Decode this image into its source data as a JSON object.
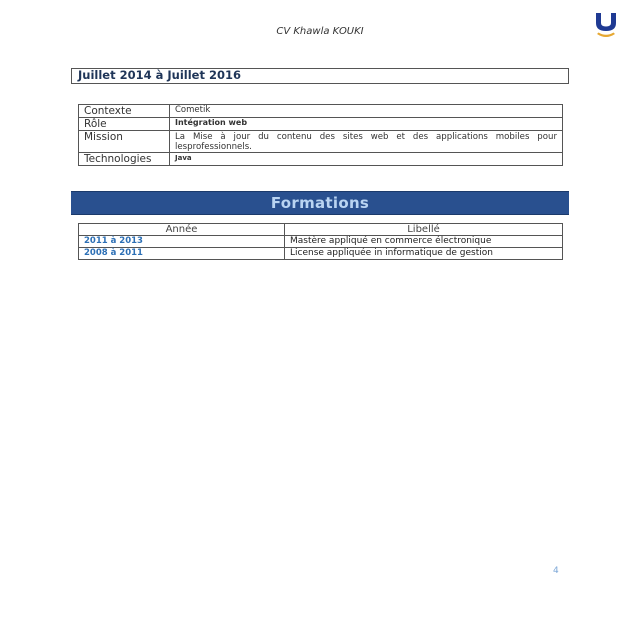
{
  "header": {
    "title": "CV Khawla KOUKI",
    "logo_color_primary": "#1f3a93",
    "logo_color_accent": "#e6a832"
  },
  "experience": {
    "period": "Juillet 2014 à Juillet 2016",
    "rows": [
      {
        "label": "Contexte",
        "value": "Cometik"
      },
      {
        "label": "Rôle",
        "value": "Intégration web"
      },
      {
        "label": "Mission",
        "value": "La Mise à jour du contenu des sites web et des applications mobiles pour lesprofessionnels."
      },
      {
        "label": "Technologies",
        "value": "Java"
      }
    ]
  },
  "formations": {
    "title": "Formations",
    "headers": {
      "year": "Année",
      "label": "Libellé"
    },
    "rows": [
      {
        "year": "2011 à 2013",
        "label": "Mastère appliqué en commerce électronique"
      },
      {
        "year": "2008 à 2011",
        "label": "License appliquée in informatique de gestion"
      }
    ]
  },
  "footer": {
    "page_number": "4"
  }
}
